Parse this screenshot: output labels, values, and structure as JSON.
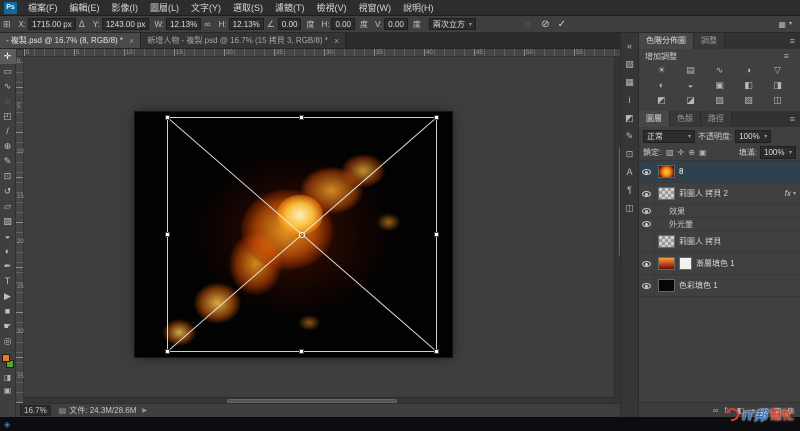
{
  "ui": {
    "chevron": "▾",
    "panel_menu": "≡",
    "workspace_icon": "▦"
  },
  "colors": {
    "foreground_swatch": "#ee7724",
    "background_swatch": "#4ea72e",
    "selected_layer_bg": "#30404c",
    "watermark_blue": "#2a6fc0",
    "watermark_red": "#d5432b"
  },
  "menubar": {
    "logo": "Ps",
    "items": [
      {
        "id": "file",
        "label": "檔案(F)"
      },
      {
        "id": "edit",
        "label": "編輯(E)"
      },
      {
        "id": "image",
        "label": "影像(I)"
      },
      {
        "id": "layer",
        "label": "圖層(L)"
      },
      {
        "id": "type",
        "label": "文字(Y)"
      },
      {
        "id": "select",
        "label": "選取(S)"
      },
      {
        "id": "filter",
        "label": "濾鏡(T)"
      },
      {
        "id": "view",
        "label": "檢視(V)"
      },
      {
        "id": "window",
        "label": "視窗(W)"
      },
      {
        "id": "help",
        "label": "說明(H)"
      }
    ]
  },
  "options": {
    "ref_icon": "⊞",
    "x_label": "X:",
    "x_value": "1715.00 px",
    "delta": "Δ",
    "y_label": "Y:",
    "y_value": "1243.00 px",
    "w_label": "W:",
    "w_value": "12.13%",
    "link": "∞",
    "h_label": "H:",
    "h_value": "12.13%",
    "angle_icon": "∠",
    "angle_value": "0.00",
    "deg": "度",
    "skew_h_label": "H:",
    "skew_h_value": "0.00",
    "skew_v_label": "V:",
    "skew_v_value": "0.00",
    "interp_value": "兩次立方",
    "warp_icon": "◌",
    "cancel_icon": "⊘",
    "commit_icon": "✓"
  },
  "tabs": [
    {
      "label": "- 複製.psd @ 16.7% (8, RGB/8) *",
      "close": "×",
      "active": true
    },
    {
      "label": "新增人物 - 複製.psd @ 16.7% (15 拷貝 3, RGB/8) *",
      "close": "×",
      "active": false
    }
  ],
  "toolbar": {
    "fg_color": "#ee7724",
    "bg_color": "#4ea72e",
    "tools": [
      {
        "name": "move-tool",
        "glyph": "✛",
        "active": true
      },
      {
        "name": "marquee-tool",
        "glyph": "▭"
      },
      {
        "name": "lasso-tool",
        "glyph": "∿"
      },
      {
        "name": "quick-selection-tool",
        "glyph": "◌"
      },
      {
        "name": "crop-tool",
        "glyph": "◰"
      },
      {
        "name": "eyedropper-tool",
        "glyph": "/"
      },
      {
        "name": "healing-brush-tool",
        "glyph": "⊕"
      },
      {
        "name": "brush-tool",
        "glyph": "✎"
      },
      {
        "name": "clone-stamp-tool",
        "glyph": "⊡"
      },
      {
        "name": "history-brush-tool",
        "glyph": "↺"
      },
      {
        "name": "eraser-tool",
        "glyph": "▱"
      },
      {
        "name": "gradient-tool",
        "glyph": "▨"
      },
      {
        "name": "blur-tool",
        "glyph": "◒"
      },
      {
        "name": "dodge-tool",
        "glyph": "◐"
      },
      {
        "name": "pen-tool",
        "glyph": "✒"
      },
      {
        "name": "type-tool",
        "glyph": "T"
      },
      {
        "name": "path-selection-tool",
        "glyph": "▶"
      },
      {
        "name": "shape-tool",
        "glyph": "■"
      },
      {
        "name": "hand-tool",
        "glyph": "☛"
      },
      {
        "name": "zoom-tool",
        "glyph": "◎"
      }
    ],
    "extra_icons": [
      {
        "name": "quick-mask-icon",
        "glyph": "◨"
      },
      {
        "name": "screen-mode-icon",
        "glyph": "▣"
      }
    ]
  },
  "rulers": {
    "h": [
      "0",
      "5",
      "10",
      "15",
      "20",
      "25",
      "30",
      "35",
      "40",
      "45",
      "50",
      "55"
    ],
    "v": [
      "0",
      "5",
      "10",
      "15",
      "20",
      "25",
      "30",
      "35"
    ]
  },
  "statusbar": {
    "zoom_value": "16.7%",
    "doc_icon": "▤",
    "doc_label": "文件: 24.3M/28.6M",
    "menu_arrow": "▶"
  },
  "dock_icons": [
    {
      "name": "expand-panels-icon",
      "glyph": "«"
    },
    {
      "name": "color-panel-icon",
      "glyph": "▧"
    },
    {
      "name": "swatches-panel-icon",
      "glyph": "▦"
    },
    {
      "name": "info-panel-icon",
      "glyph": "i"
    },
    {
      "name": "styles-panel-icon",
      "glyph": "◩"
    },
    {
      "name": "brush-panel-icon",
      "glyph": "✎"
    },
    {
      "name": "clone-source-panel-icon",
      "glyph": "⊡"
    },
    {
      "name": "character-panel-icon",
      "glyph": "A"
    },
    {
      "name": "paragraph-panel-icon",
      "glyph": "¶"
    },
    {
      "name": "timeline-panel-icon",
      "glyph": "◫"
    }
  ],
  "adjustments": {
    "tabs": [
      {
        "id": "histogram",
        "label": "色階分佈圖",
        "active": true
      },
      {
        "id": "adjustments",
        "label": "調整",
        "active": false
      }
    ],
    "title": "增加調整",
    "icons": [
      "☀",
      "▤",
      "∿",
      "◑",
      "▽",
      "◐",
      "◒",
      "▣",
      "◧",
      "◨",
      "◩",
      "◪",
      "▨",
      "▧",
      "◫"
    ]
  },
  "layers_panel": {
    "tabs": [
      {
        "id": "layers",
        "label": "圖層",
        "active": true
      },
      {
        "id": "channels",
        "label": "色版",
        "active": false
      },
      {
        "id": "paths",
        "label": "路徑",
        "active": false
      }
    ],
    "blend_mode": "正常",
    "opacity_label": "不透明度:",
    "opacity_value": "100%",
    "lock_label": "鎖定:",
    "lock_icons": [
      {
        "name": "lock-transparency-icon",
        "glyph": "▨"
      },
      {
        "name": "lock-position-icon",
        "glyph": "✛"
      },
      {
        "name": "lock-pixels-icon",
        "glyph": "⊕"
      },
      {
        "name": "lock-all-icon",
        "glyph": "▣"
      }
    ],
    "fill_label": "填滿:",
    "fill_value": "100%",
    "fx_label": "fx",
    "layers": [
      {
        "name": "8",
        "thumb": "fire",
        "visible": true,
        "selected": true
      },
      {
        "name": "莉圖人 拷貝 2",
        "thumb": "checker",
        "visible": true,
        "fx": true
      },
      {
        "name": "效果",
        "sub": true,
        "visible": true
      },
      {
        "name": "外光暈",
        "sub": true,
        "visible": true
      },
      {
        "name": "莉圖人 拷貝",
        "thumb": "checker",
        "visible": false
      },
      {
        "name": "漸層填色 1",
        "thumb": "gradient",
        "visible": true,
        "mask": true
      },
      {
        "name": "色彩填色 1",
        "thumb": "black",
        "visible": true
      }
    ],
    "footer_icons": [
      {
        "name": "link-layers-icon",
        "glyph": "∞"
      },
      {
        "name": "layer-style-icon",
        "glyph": "fx"
      },
      {
        "name": "add-mask-icon",
        "glyph": "◧"
      },
      {
        "name": "adjustment-layer-icon",
        "glyph": "◑"
      },
      {
        "name": "new-group-icon",
        "glyph": "▢"
      },
      {
        "name": "new-layer-icon",
        "glyph": "⊞"
      },
      {
        "name": "delete-layer-icon",
        "glyph": "⊠"
      }
    ]
  },
  "watermark": {
    "it": "iT邦",
    "help": "幫忙"
  }
}
